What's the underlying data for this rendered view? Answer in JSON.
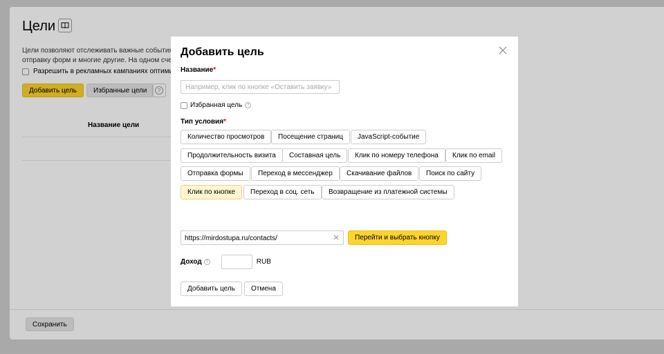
{
  "background": {
    "title": "Цели",
    "description_line1": "Цели позволяют отслеживать важные события н",
    "description_line2": "отправку форм и многие другие. На одном счетч",
    "allow_label": "Разрешить в рекламных кампаниях оптимиза",
    "add_goal": "Добавить цель",
    "favorite_goals": "Избранные цели",
    "help": "?",
    "column_name": "Название цели",
    "save": "Сохранить"
  },
  "modal": {
    "title": "Добавить цель",
    "name_label": "Название",
    "required_mark": "*",
    "name_placeholder": "Например, клик по кнопке «Оставить заявку»",
    "favorite_label": "Избранная цель",
    "condition_label": "Тип условия",
    "condition_types": [
      "Количество просмотров",
      "Посещение страниц",
      "JavaScript-событие",
      "Продолжительность визита",
      "Составная цель",
      "Клик по номеру телефона",
      "Клик по email",
      "Отправка формы",
      "Переход в мессенджер",
      "Скачивание файлов",
      "Поиск по сайту",
      "Клик по кнопке",
      "Переход в соц. сеть",
      "Возвращение из платежной системы"
    ],
    "selected_condition": "Клик по кнопке",
    "url_value": "https://mirdostupa.ru/contacts/",
    "goto_button": "Перейти и выбрать кнопку",
    "income_label": "Доход",
    "income_value": "",
    "currency": "RUB",
    "add_button": "Добавить цель",
    "cancel_button": "Отмена"
  },
  "colors": {
    "accent_yellow": "#fed42b",
    "selected_tag_bg": "#fff7d1",
    "required": "#ee0000"
  }
}
